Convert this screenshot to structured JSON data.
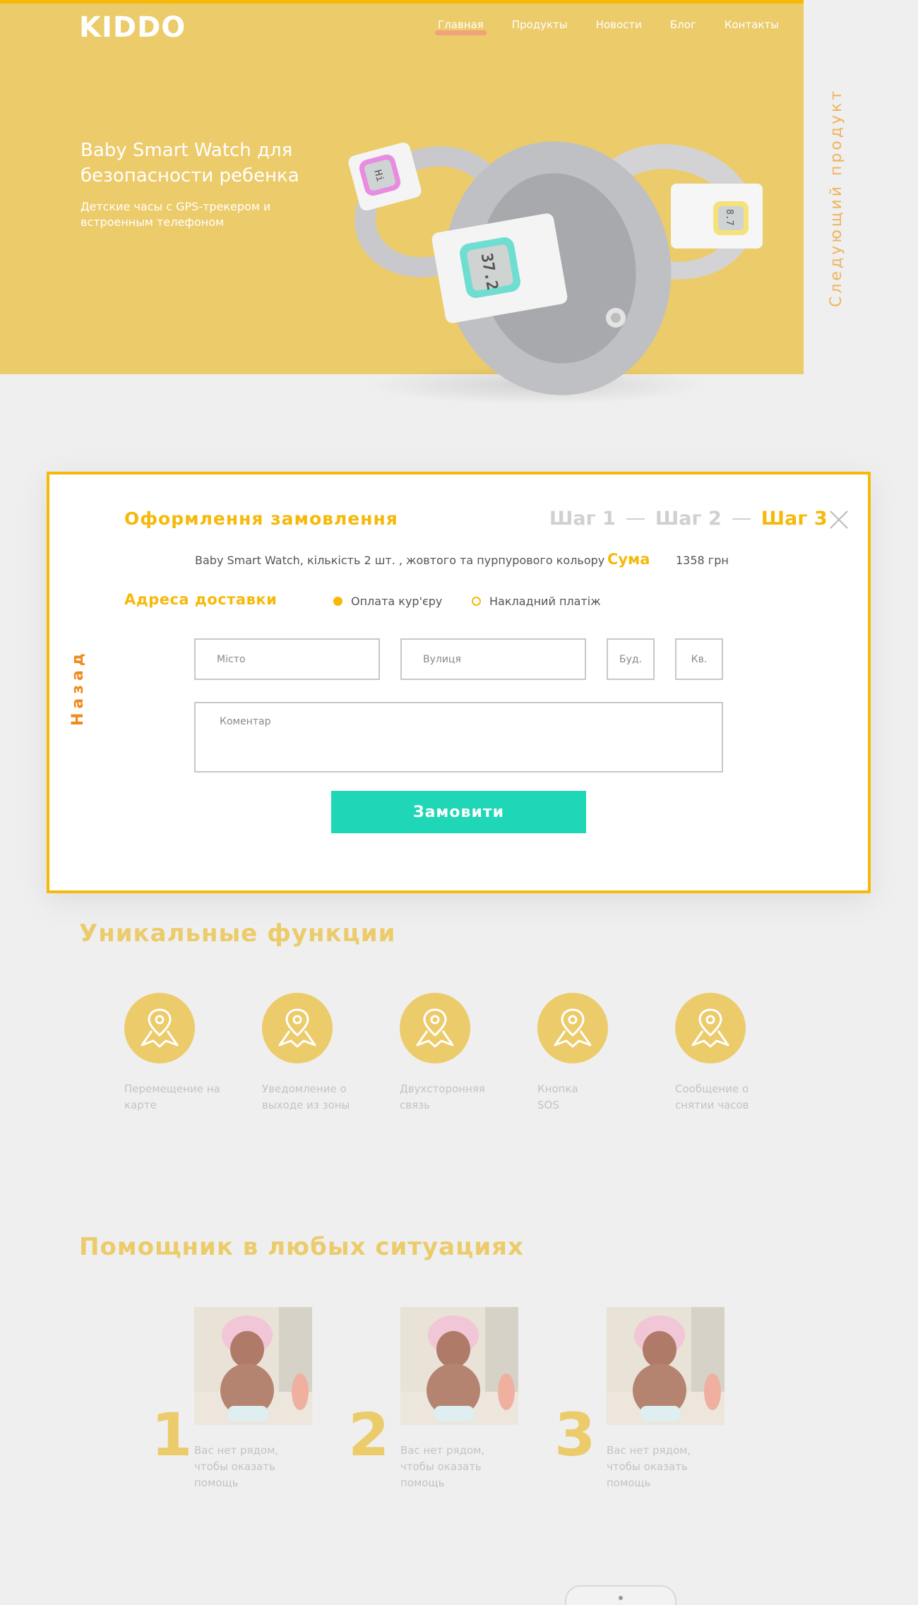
{
  "header": {
    "logo": "KIDDO",
    "nav": [
      "Главная",
      "Продукты",
      "Новости",
      "Блог",
      "Контакты"
    ],
    "active_nav": "Главная"
  },
  "hero": {
    "title": "Baby Smart Watch для безопасности ребенка",
    "subtitle": "Детские часы с GPS-трекером и встроенным телефоном",
    "next_product": "Следующий продукт",
    "watch_readouts": [
      "Hi",
      "37.2",
      "8.7"
    ]
  },
  "modal": {
    "title": "Оформлення замовлення",
    "steps": [
      "Шаг 1",
      "Шаг 2",
      "Шаг 3"
    ],
    "active_step": 3,
    "back": "Назад",
    "order_description": "Baby Smart Watch, кількість 2 шт. , жовтого та пурпурового кольору",
    "sum_label": "Сума",
    "sum_value": "1358 грн",
    "delivery_title": "Адреса доставки",
    "payment_options": [
      {
        "label": "Оплата кур'єру",
        "selected": true
      },
      {
        "label": "Накладний платіж",
        "selected": false
      }
    ],
    "fields": {
      "city": "Місто",
      "street": "Вулиця",
      "building": "Буд.",
      "apartment": "Кв.",
      "comment": "Коментар"
    },
    "submit": "Замовити"
  },
  "features": {
    "title": "Уникальные функции",
    "items": [
      "Перемещение на карте",
      "Уведомление о выходе из зоны",
      "Двухсторонняя связь",
      "Кнопка SOS",
      "Сообщение о снятии часов"
    ]
  },
  "helper": {
    "title": "Помощник в любых ситуациях",
    "items": [
      {
        "number": "1",
        "text": "Вас нет рядом, чтобы оказать помощь"
      },
      {
        "number": "2",
        "text": "Вас нет рядом, чтобы оказать помощь"
      },
      {
        "number": "3",
        "text": "Вас нет рядом, чтобы оказать помощь"
      }
    ]
  },
  "colors": {
    "brand_yellow": "#eccb6b",
    "accent_yellow": "#f6b90a",
    "accent_orange": "#f08a1c",
    "cta_teal": "#1fd6b6",
    "page_bg": "#efefef"
  },
  "icons": {
    "feature_icon": "map-pin-icon",
    "close": "close-icon"
  }
}
